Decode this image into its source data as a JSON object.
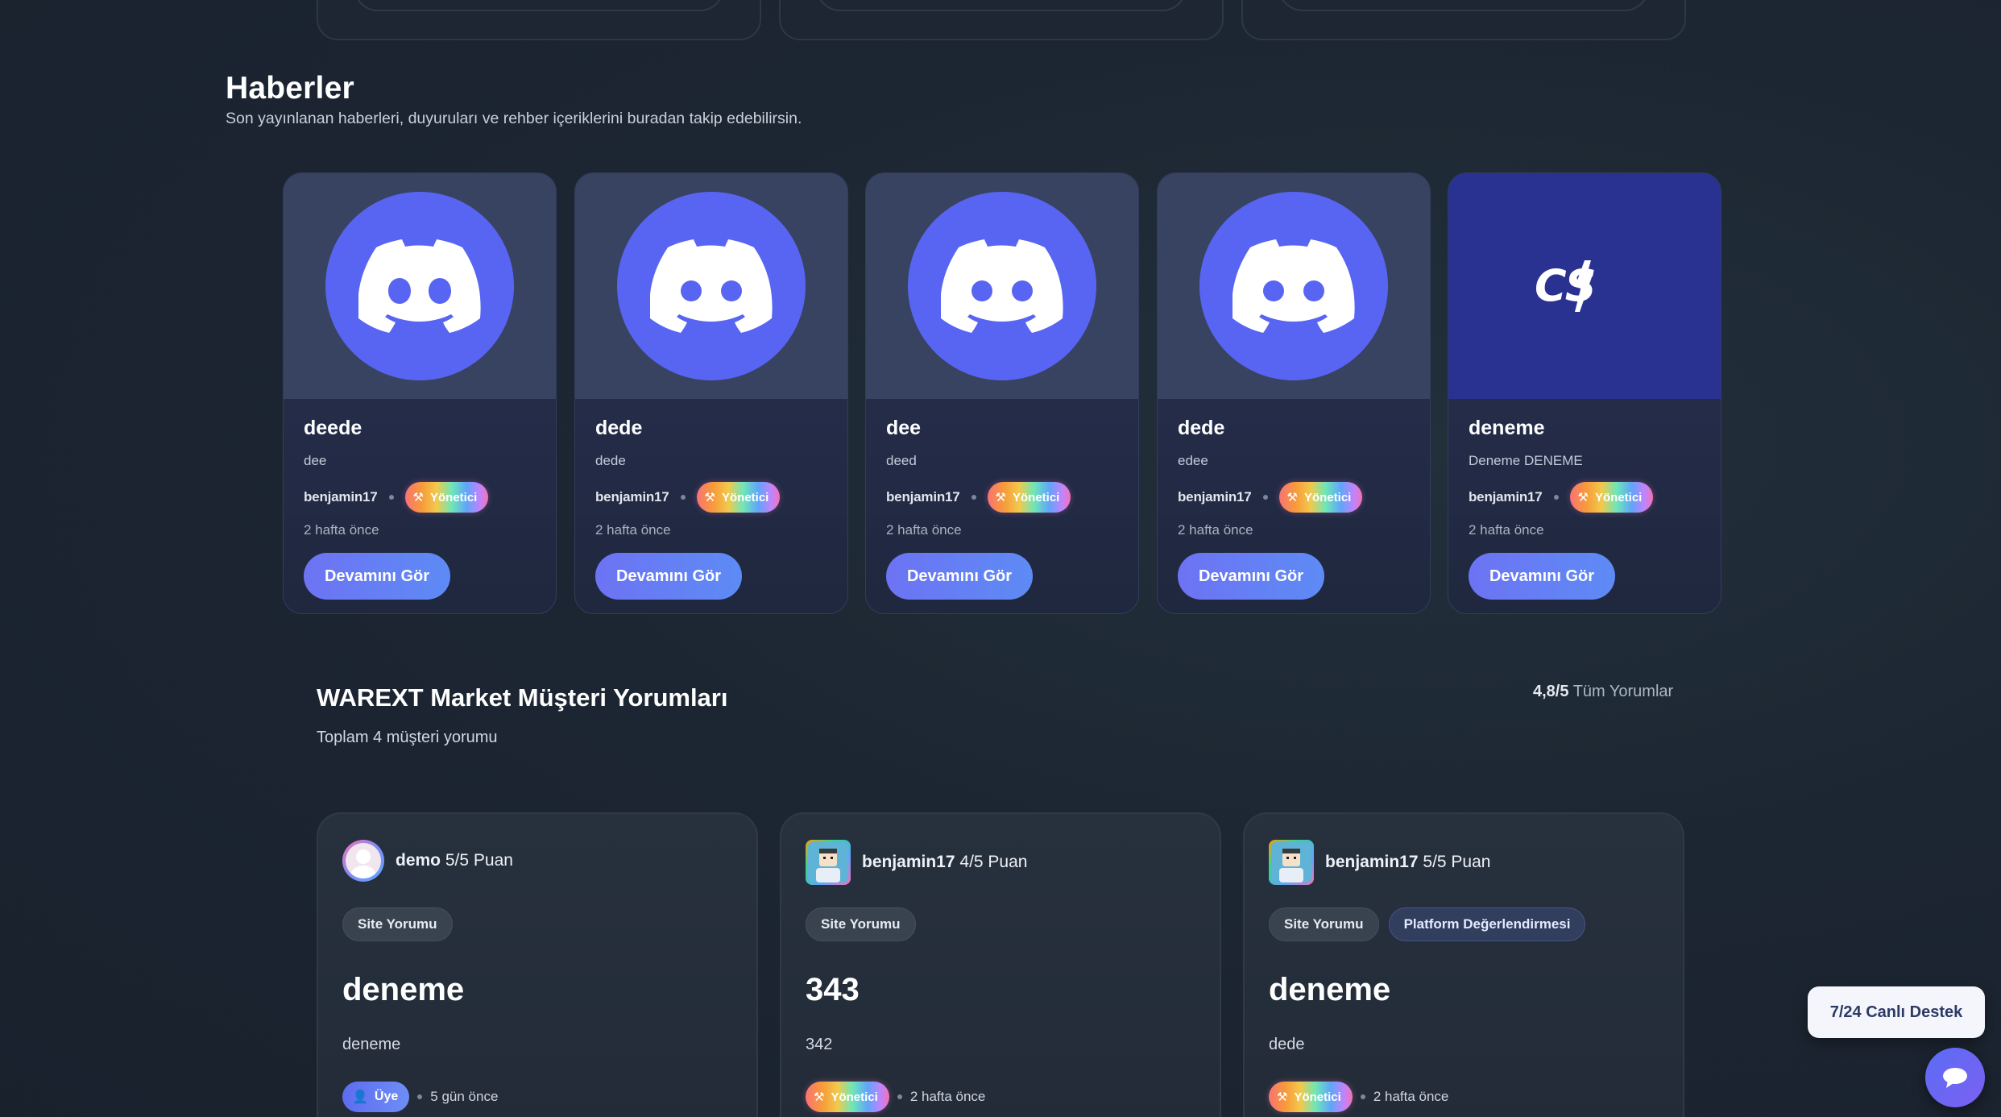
{
  "news": {
    "title": "Haberler",
    "subtitle": "Son yayınlanan haberleri, duyuruları ve rehber içeriklerini buradan takip edebilirsin.",
    "items": [
      {
        "title": "deede",
        "desc": "dee",
        "author": "benjamin17",
        "role": "Yönetici",
        "time": "2 hafta önce",
        "button": "Devamını Gör",
        "image": "discord-logo"
      },
      {
        "title": "dede",
        "desc": "dede",
        "author": "benjamin17",
        "role": "Yönetici",
        "time": "2 hafta önce",
        "button": "Devamını Gör",
        "image": "discord-logo"
      },
      {
        "title": "dee",
        "desc": "deed",
        "author": "benjamin17",
        "role": "Yönetici",
        "time": "2 hafta önce",
        "button": "Devamını Gör",
        "image": "discord-logo"
      },
      {
        "title": "dede",
        "desc": "edee",
        "author": "benjamin17",
        "role": "Yönetici",
        "time": "2 hafta önce",
        "button": "Devamını Gör",
        "image": "discord-logo"
      },
      {
        "title": "deneme",
        "desc": "Deneme DENEME",
        "author": "benjamin17",
        "role": "Yönetici",
        "time": "2 hafta önce",
        "button": "Devamını Gör",
        "image": "cs2-logo",
        "image_text": "CS"
      }
    ]
  },
  "reviews": {
    "title": "WAREXT Market Müşteri Yorumları",
    "subtitle": "Toplam 4 müşteri yorumu",
    "rating": "4,8/5",
    "all_label": "Tüm Yorumlar",
    "items": [
      {
        "user": "demo",
        "score": "5/5 Puan",
        "tags": [
          "Site Yorumu"
        ],
        "title": "deneme",
        "text": "deneme",
        "role": "Üye",
        "time": "5 gün önce",
        "avatar": "default-avatar"
      },
      {
        "user": "benjamin17",
        "score": "4/5 Puan",
        "tags": [
          "Site Yorumu"
        ],
        "title": "343",
        "text": "342",
        "role": "Yönetici",
        "time": "2 hafta önce",
        "avatar": "pixel-avatar"
      },
      {
        "user": "benjamin17",
        "score": "5/5 Puan",
        "tags": [
          "Site Yorumu",
          "Platform Değerlendirmesi"
        ],
        "title": "deneme",
        "text": "dede",
        "role": "Yönetici",
        "time": "2 hafta önce",
        "avatar": "pixel-avatar"
      }
    ]
  },
  "support": {
    "label": "7/24 Canlı Destek",
    "icon": "chat-bubble-icon"
  },
  "colors": {
    "background": "#1c2632",
    "discord": "#5865f2",
    "button": "#6d73f3",
    "cs_background": "#293290"
  }
}
